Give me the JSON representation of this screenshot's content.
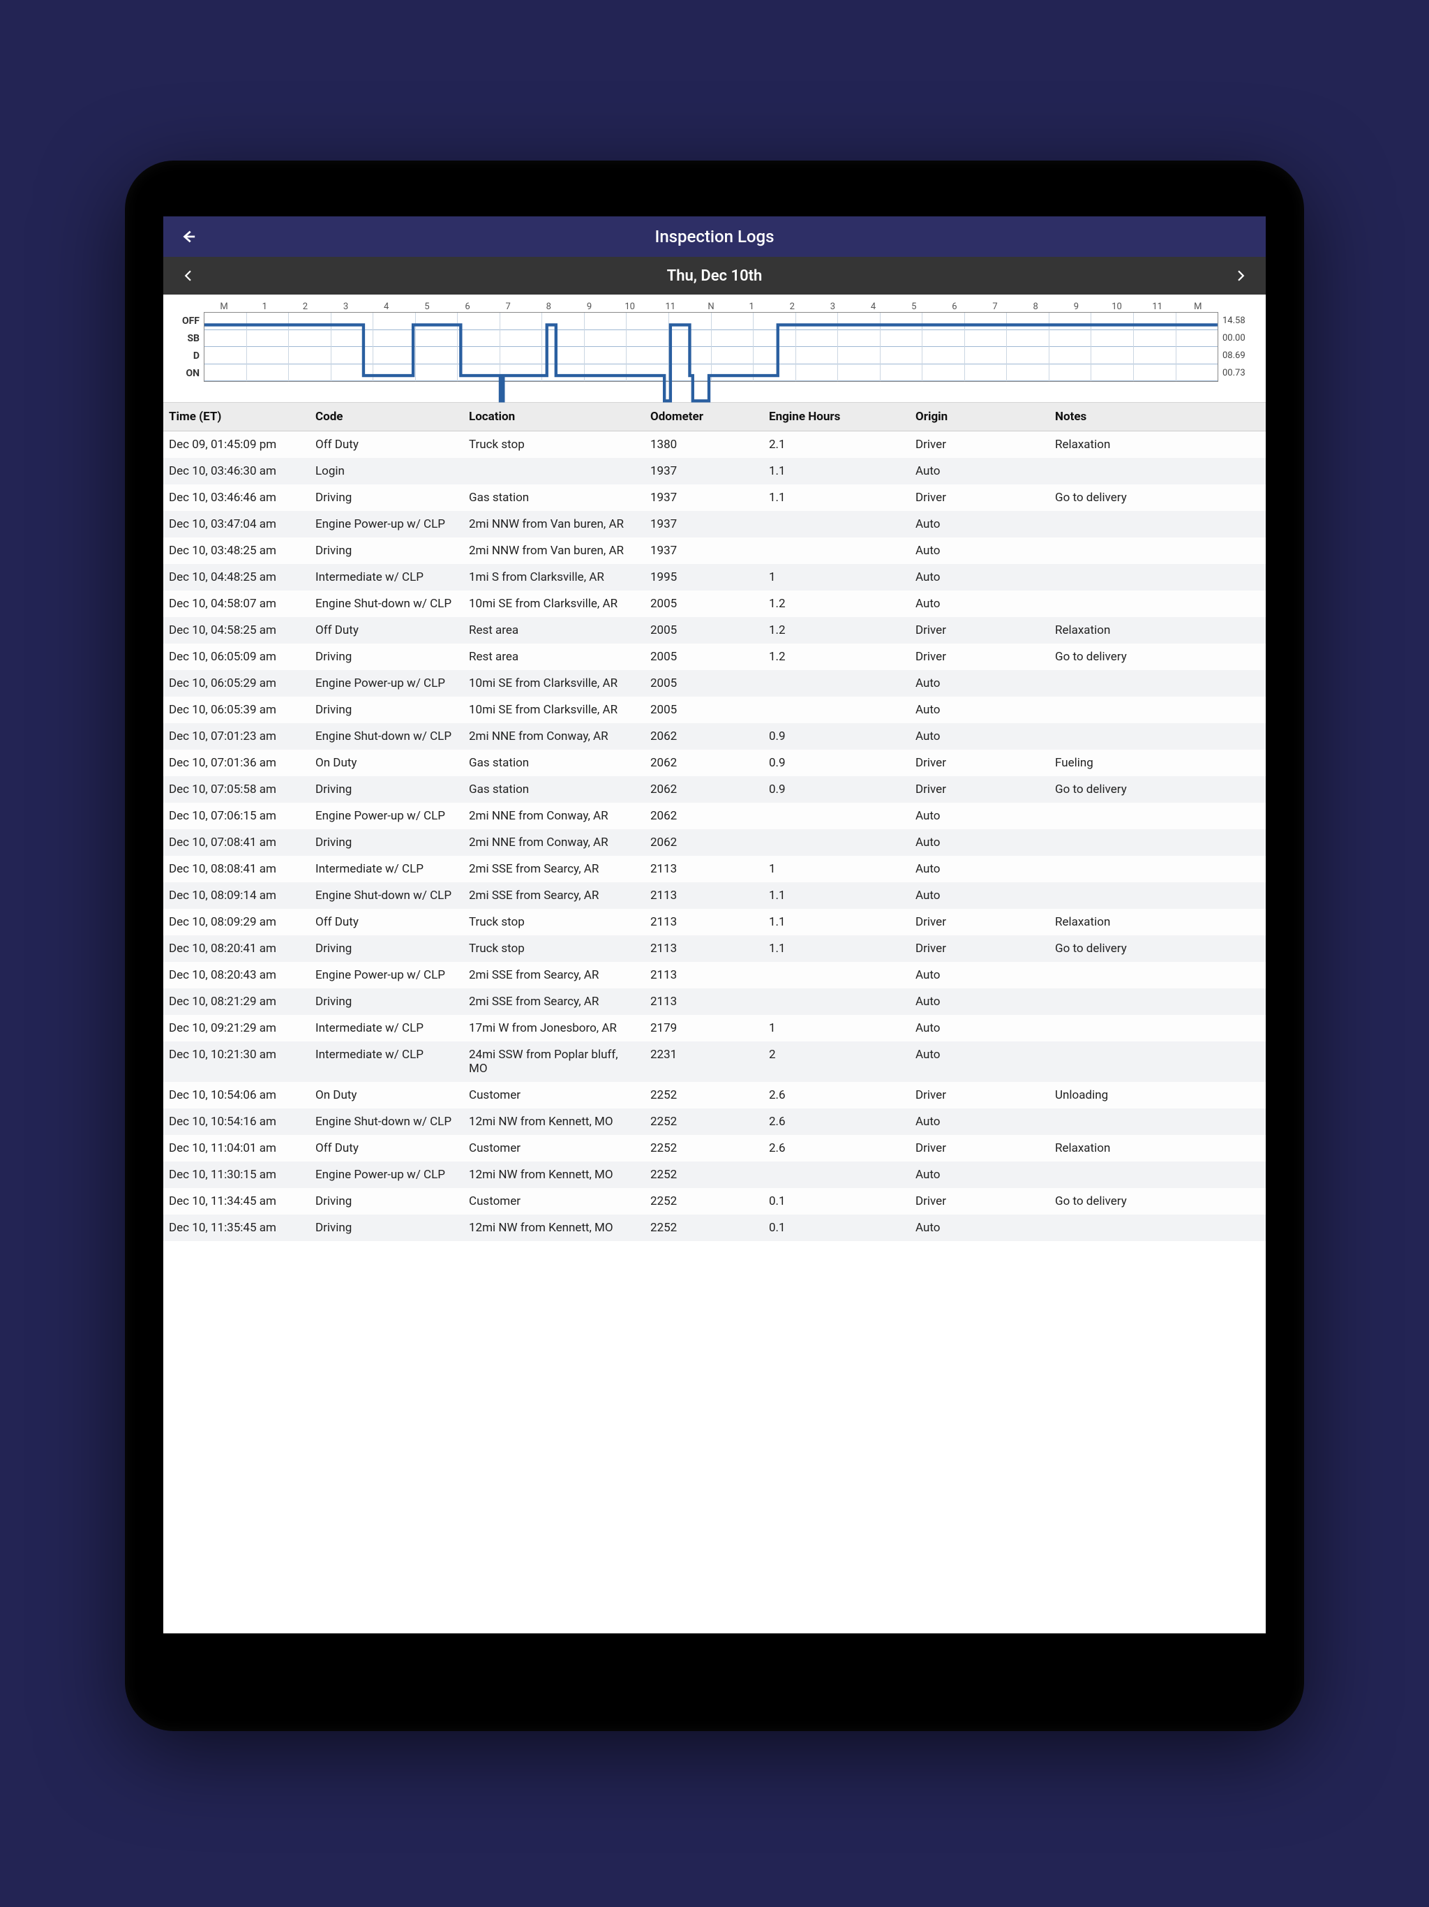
{
  "header": {
    "title": "Inspection Logs"
  },
  "datebar": {
    "label": "Thu, Dec 10th"
  },
  "timeline": {
    "topStart": "M",
    "topMid": "N",
    "topEnd": "M",
    "hours": [
      "1",
      "2",
      "3",
      "4",
      "5",
      "6",
      "7",
      "8",
      "9",
      "10",
      "11",
      "",
      "1",
      "2",
      "3",
      "4",
      "5",
      "6",
      "7",
      "8",
      "9",
      "10",
      "11"
    ],
    "rowLabels": [
      "OFF",
      "SB",
      "D",
      "ON"
    ],
    "rowTotals": [
      "14.58",
      "00.00",
      "08.69",
      "00.73"
    ]
  },
  "columns": {
    "time": "Time (ET)",
    "code": "Code",
    "location": "Location",
    "odometer": "Odometer",
    "engine": "Engine Hours",
    "origin": "Origin",
    "notes": "Notes"
  },
  "rows": [
    {
      "time": "Dec 09, 01:45:09 pm",
      "code": "Off Duty",
      "location": "Truck stop",
      "odometer": "1380",
      "engine": "2.1",
      "origin": "Driver",
      "notes": "Relaxation"
    },
    {
      "time": "Dec 10, 03:46:30 am",
      "code": "Login",
      "location": "",
      "odometer": "1937",
      "engine": "1.1",
      "origin": "Auto",
      "notes": ""
    },
    {
      "time": "Dec 10, 03:46:46 am",
      "code": "Driving",
      "location": "Gas station",
      "odometer": "1937",
      "engine": "1.1",
      "origin": "Driver",
      "notes": "Go to delivery"
    },
    {
      "time": "Dec 10, 03:47:04 am",
      "code": "Engine Power-up w/ CLP",
      "location": "2mi NNW from Van buren, AR",
      "odometer": "1937",
      "engine": "",
      "origin": "Auto",
      "notes": ""
    },
    {
      "time": "Dec 10, 03:48:25 am",
      "code": "Driving",
      "location": "2mi NNW from Van buren, AR",
      "odometer": "1937",
      "engine": "",
      "origin": "Auto",
      "notes": ""
    },
    {
      "time": "Dec 10, 04:48:25 am",
      "code": "Intermediate w/ CLP",
      "location": "1mi S from Clarksville, AR",
      "odometer": "1995",
      "engine": "1",
      "origin": "Auto",
      "notes": ""
    },
    {
      "time": "Dec 10, 04:58:07 am",
      "code": "Engine Shut-down w/ CLP",
      "location": "10mi SE from Clarksville, AR",
      "odometer": "2005",
      "engine": "1.2",
      "origin": "Auto",
      "notes": ""
    },
    {
      "time": "Dec 10, 04:58:25 am",
      "code": "Off Duty",
      "location": "Rest area",
      "odometer": "2005",
      "engine": "1.2",
      "origin": "Driver",
      "notes": "Relaxation"
    },
    {
      "time": "Dec 10, 06:05:09 am",
      "code": "Driving",
      "location": "Rest area",
      "odometer": "2005",
      "engine": "1.2",
      "origin": "Driver",
      "notes": "Go to delivery"
    },
    {
      "time": "Dec 10, 06:05:29 am",
      "code": "Engine Power-up w/ CLP",
      "location": "10mi SE from Clarksville, AR",
      "odometer": "2005",
      "engine": "",
      "origin": "Auto",
      "notes": ""
    },
    {
      "time": "Dec 10, 06:05:39 am",
      "code": "Driving",
      "location": "10mi SE from Clarksville, AR",
      "odometer": "2005",
      "engine": "",
      "origin": "Auto",
      "notes": ""
    },
    {
      "time": "Dec 10, 07:01:23 am",
      "code": "Engine Shut-down w/ CLP",
      "location": "2mi NNE from Conway, AR",
      "odometer": "2062",
      "engine": "0.9",
      "origin": "Auto",
      "notes": ""
    },
    {
      "time": "Dec 10, 07:01:36 am",
      "code": "On Duty",
      "location": "Gas station",
      "odometer": "2062",
      "engine": "0.9",
      "origin": "Driver",
      "notes": "Fueling"
    },
    {
      "time": "Dec 10, 07:05:58 am",
      "code": "Driving",
      "location": "Gas station",
      "odometer": "2062",
      "engine": "0.9",
      "origin": "Driver",
      "notes": "Go to delivery"
    },
    {
      "time": "Dec 10, 07:06:15 am",
      "code": "Engine Power-up w/ CLP",
      "location": "2mi NNE from Conway, AR",
      "odometer": "2062",
      "engine": "",
      "origin": "Auto",
      "notes": ""
    },
    {
      "time": "Dec 10, 07:08:41 am",
      "code": "Driving",
      "location": "2mi NNE from Conway, AR",
      "odometer": "2062",
      "engine": "",
      "origin": "Auto",
      "notes": ""
    },
    {
      "time": "Dec 10, 08:08:41 am",
      "code": "Intermediate w/ CLP",
      "location": "2mi SSE from Searcy, AR",
      "odometer": "2113",
      "engine": "1",
      "origin": "Auto",
      "notes": ""
    },
    {
      "time": "Dec 10, 08:09:14 am",
      "code": "Engine Shut-down w/ CLP",
      "location": "2mi SSE from Searcy, AR",
      "odometer": "2113",
      "engine": "1.1",
      "origin": "Auto",
      "notes": ""
    },
    {
      "time": "Dec 10, 08:09:29 am",
      "code": "Off Duty",
      "location": "Truck stop",
      "odometer": "2113",
      "engine": "1.1",
      "origin": "Driver",
      "notes": "Relaxation"
    },
    {
      "time": "Dec 10, 08:20:41 am",
      "code": "Driving",
      "location": "Truck stop",
      "odometer": "2113",
      "engine": "1.1",
      "origin": "Driver",
      "notes": "Go to delivery"
    },
    {
      "time": "Dec 10, 08:20:43 am",
      "code": "Engine Power-up w/ CLP",
      "location": "2mi SSE from Searcy, AR",
      "odometer": "2113",
      "engine": "",
      "origin": "Auto",
      "notes": ""
    },
    {
      "time": "Dec 10, 08:21:29 am",
      "code": "Driving",
      "location": "2mi SSE from Searcy, AR",
      "odometer": "2113",
      "engine": "",
      "origin": "Auto",
      "notes": ""
    },
    {
      "time": "Dec 10, 09:21:29 am",
      "code": "Intermediate w/ CLP",
      "location": "17mi W from Jonesboro, AR",
      "odometer": "2179",
      "engine": "1",
      "origin": "Auto",
      "notes": ""
    },
    {
      "time": "Dec 10, 10:21:30 am",
      "code": "Intermediate w/ CLP",
      "location": "24mi SSW from Poplar bluff, MO",
      "odometer": "2231",
      "engine": "2",
      "origin": "Auto",
      "notes": ""
    },
    {
      "time": "Dec 10, 10:54:06 am",
      "code": "On Duty",
      "location": "Customer",
      "odometer": "2252",
      "engine": "2.6",
      "origin": "Driver",
      "notes": "Unloading"
    },
    {
      "time": "Dec 10, 10:54:16 am",
      "code": "Engine Shut-down w/ CLP",
      "location": "12mi NW from Kennett, MO",
      "odometer": "2252",
      "engine": "2.6",
      "origin": "Auto",
      "notes": ""
    },
    {
      "time": "Dec 10, 11:04:01 am",
      "code": "Off Duty",
      "location": "Customer",
      "odometer": "2252",
      "engine": "2.6",
      "origin": "Driver",
      "notes": "Relaxation"
    },
    {
      "time": "Dec 10, 11:30:15 am",
      "code": "Engine Power-up w/ CLP",
      "location": "12mi NW from Kennett, MO",
      "odometer": "2252",
      "engine": "",
      "origin": "Auto",
      "notes": ""
    },
    {
      "time": "Dec 10, 11:34:45 am",
      "code": "Driving",
      "location": "Customer",
      "odometer": "2252",
      "engine": "0.1",
      "origin": "Driver",
      "notes": "Go to delivery"
    },
    {
      "time": "Dec 10, 11:35:45 am",
      "code": "Driving",
      "location": "12mi NW from Kennett, MO",
      "odometer": "2252",
      "engine": "0.1",
      "origin": "Auto",
      "notes": ""
    }
  ]
}
